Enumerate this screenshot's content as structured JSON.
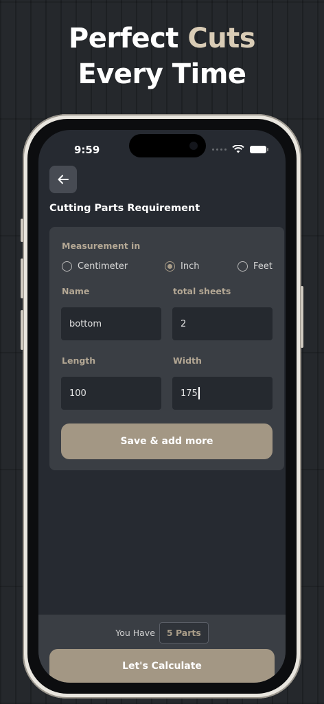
{
  "headline": {
    "line1_plain": "Perfect ",
    "line1_accent": "Cuts",
    "line2": "Every Time"
  },
  "status_bar": {
    "time": "9:59"
  },
  "screen": {
    "title": "Cutting Parts Requirement",
    "measurement": {
      "label": "Measurement  in",
      "options": [
        {
          "label": "Centimeter",
          "selected": false
        },
        {
          "label": "Inch",
          "selected": true
        },
        {
          "label": "Feet",
          "selected": false
        }
      ]
    },
    "fields": {
      "name_label": "Name",
      "name_value": "bottom",
      "sheets_label": "total sheets",
      "sheets_value": "2",
      "length_label": "Length",
      "length_value": "100",
      "width_label": "Width",
      "width_value": "175"
    },
    "save_button": "Save & add more",
    "footer": {
      "you_have": "You Have",
      "parts": "5 Parts",
      "calculate_button": "Let's Calculate"
    }
  },
  "colors": {
    "accent": "#a39784",
    "headline_accent": "#d9ccb6",
    "screen_bg": "#262a31",
    "card_bg": "#3a3e44",
    "input_bg": "#25292f"
  }
}
